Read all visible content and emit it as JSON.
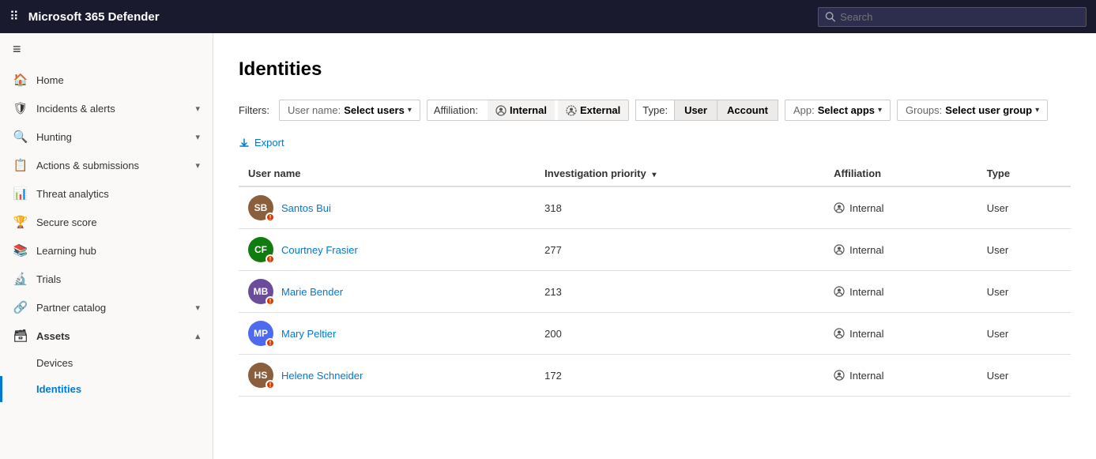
{
  "topbar": {
    "title": "Microsoft 365 Defender",
    "search_placeholder": "Search"
  },
  "sidebar": {
    "toggle_label": "≡",
    "items": [
      {
        "id": "home",
        "icon": "🏠",
        "label": "Home",
        "hasChevron": false,
        "active": false
      },
      {
        "id": "incidents",
        "icon": "🛡",
        "label": "Incidents & alerts",
        "hasChevron": true,
        "active": false
      },
      {
        "id": "hunting",
        "icon": "🔍",
        "label": "Hunting",
        "hasChevron": true,
        "active": false
      },
      {
        "id": "actions",
        "icon": "📋",
        "label": "Actions & submissions",
        "hasChevron": true,
        "active": false
      },
      {
        "id": "threat",
        "icon": "📊",
        "label": "Threat analytics",
        "hasChevron": false,
        "active": false
      },
      {
        "id": "secure",
        "icon": "🏆",
        "label": "Secure score",
        "hasChevron": false,
        "active": false
      },
      {
        "id": "learning",
        "icon": "📚",
        "label": "Learning hub",
        "hasChevron": false,
        "active": false
      },
      {
        "id": "trials",
        "icon": "🔬",
        "label": "Trials",
        "hasChevron": false,
        "active": false
      },
      {
        "id": "partner",
        "icon": "🔗",
        "label": "Partner catalog",
        "hasChevron": true,
        "active": false
      },
      {
        "id": "assets",
        "icon": "🗃",
        "label": "Assets",
        "hasChevron": true,
        "isSection": true,
        "active": false
      },
      {
        "id": "devices",
        "icon": "💻",
        "label": "Devices",
        "isSub": true,
        "active": false
      },
      {
        "id": "identities",
        "icon": "👤",
        "label": "Identities",
        "isSub": true,
        "active": true
      }
    ]
  },
  "main": {
    "page_title": "Identities",
    "filters": {
      "label": "Filters:",
      "username_label": "User name:",
      "username_value": "Select users",
      "affiliation_label": "Affiliation:",
      "affiliation_internal": "Internal",
      "affiliation_external": "External",
      "type_label": "Type:",
      "type_user": "User",
      "type_account": "Account",
      "app_label": "App:",
      "app_value": "Select apps",
      "groups_label": "Groups:",
      "groups_value": "Select user group"
    },
    "export_label": "Export",
    "table": {
      "columns": [
        {
          "id": "username",
          "label": "User name",
          "sortable": false
        },
        {
          "id": "priority",
          "label": "Investigation priority",
          "sortable": true
        },
        {
          "id": "affiliation",
          "label": "Affiliation",
          "sortable": false
        },
        {
          "id": "type",
          "label": "Type",
          "sortable": false
        }
      ],
      "rows": [
        {
          "name": "Santos Bui",
          "initials": "SB",
          "avatarColor": "#8B5E3C",
          "hasPhoto": true,
          "photoInitials": "SB",
          "priority": 318,
          "affiliation": "Internal",
          "type": "User"
        },
        {
          "name": "Courtney Frasier",
          "initials": "CF",
          "avatarColor": "#107c10",
          "hasPhoto": false,
          "priority": 277,
          "affiliation": "Internal",
          "type": "User"
        },
        {
          "name": "Marie Bender",
          "initials": "MB",
          "avatarColor": "#6B4C9A",
          "hasPhoto": false,
          "priority": 213,
          "affiliation": "Internal",
          "type": "User"
        },
        {
          "name": "Mary Peltier",
          "initials": "MP",
          "avatarColor": "#4F6BED",
          "hasPhoto": false,
          "priority": 200,
          "affiliation": "Internal",
          "type": "User"
        },
        {
          "name": "Helene Schneider",
          "initials": "HS",
          "avatarColor": "#8B5E3C",
          "hasPhoto": true,
          "photoInitials": "HS",
          "priority": 172,
          "affiliation": "Internal",
          "type": "User"
        }
      ]
    }
  }
}
